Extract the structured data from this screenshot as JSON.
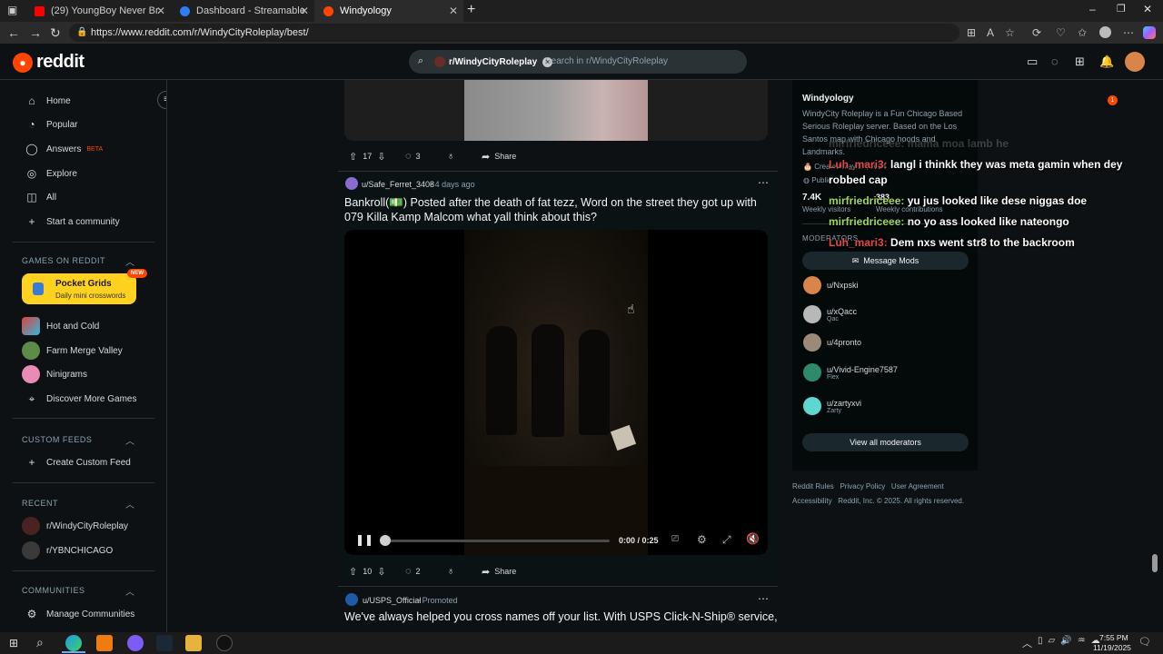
{
  "browser": {
    "tabs": [
      {
        "label": "(29) YoungBoy Never Broke Again...",
        "color": "#ff0000"
      },
      {
        "label": "Dashboard - Streamable",
        "color": "#2f7df6"
      },
      {
        "label": "Windyology",
        "color": "#ff4500"
      }
    ],
    "new_tab": "+",
    "url": "https://www.reddit.com/r/WindyCityRoleplay/best/"
  },
  "header": {
    "logo_text": "reddit",
    "search_chip": "r/WindyCityRoleplay",
    "search_placeholder": "Search in r/WindyCityRoleplay",
    "notif_count": "1"
  },
  "sidebar": {
    "main": [
      {
        "label": "Home",
        "icon": "home-icon"
      },
      {
        "label": "Popular",
        "icon": "popular-icon"
      },
      {
        "label": "Answers",
        "icon": "answers-icon",
        "badge": "BETA"
      },
      {
        "label": "Explore",
        "icon": "explore-icon"
      },
      {
        "label": "All",
        "icon": "all-icon"
      },
      {
        "label": "Start a community",
        "icon": "plus-icon"
      }
    ],
    "games_title": "GAMES ON REDDIT",
    "featured_game": {
      "name": "Pocket Grids",
      "sub": "Daily mini crosswords",
      "badge": "NEW"
    },
    "games": [
      "Hot and Cold",
      "Farm Merge Valley",
      "Ninigrams",
      "Discover More Games"
    ],
    "custom_title": "CUSTOM FEEDS",
    "custom_create": "Create Custom Feed",
    "recent_title": "RECENT",
    "recent": [
      "r/WindyCityRoleplay",
      "r/YBNCHICAGO"
    ],
    "communities_title": "COMMUNITIES",
    "manage": "Manage Communities"
  },
  "posts": [
    {
      "votes": "17",
      "comments": "3",
      "share": "Share"
    },
    {
      "author": "u/Safe_Ferret_3408",
      "age": "4 days ago",
      "title_line1": "Bankroll(💵) Posted after the death of fat tezz, Word on the street they got up with",
      "title_line2": "079 Killa Kamp Malcom what yall think about this?",
      "time": "0:00 / 0:25",
      "votes": "10",
      "comments": "2",
      "share": "Share"
    },
    {
      "author": "u/USPS_Official",
      "tag": "Promoted",
      "title": "We've always helped you cross names off your list. With USPS Click-N-Ship® service,"
    }
  ],
  "about": {
    "name": "Windyology",
    "desc": "WindyCity Roleplay is a Fun Chicago Based Serious Roleplay server. Based on the Los Santos map with Chicago hoods and Landmarks.",
    "created": "Created May 17, 2024",
    "public": "Public",
    "visitors_num": "7.4K",
    "visitors_label": "Weekly visitors",
    "contrib_num": "383",
    "contrib_label": "Weekly contributions",
    "mods_title": "MODERATORS",
    "message_mods": "Message Mods",
    "mods": [
      {
        "name": "u/Nxpski",
        "flair": ""
      },
      {
        "name": "u/xQacc",
        "flair": "Qac"
      },
      {
        "name": "u/4pronto",
        "flair": ""
      },
      {
        "name": "u/Vivid-Engine7587",
        "flair": "Flex"
      },
      {
        "name": "u/zartyxvi",
        "flair": "Zarty"
      }
    ],
    "view_all": "View all moderators"
  },
  "footer": {
    "links1": "Reddit Rules   Privacy Policy   User Agreement",
    "links2": "Accessibility   Reddit, Inc. © 2025. All rights reserved."
  },
  "chat": [
    {
      "user": "Luh_mari3:",
      "text": "langl i thinkk they was meta gamin when dey",
      "red": true
    },
    {
      "user": "",
      "text": "robbed cap",
      "red": false
    },
    {
      "user": "mirfriedriceee:",
      "text": "yu jus looked like dese niggas doe",
      "red": false
    },
    {
      "user": "mirfriedriceee:",
      "text": "no yo ass looked like nateongo",
      "red": false
    },
    {
      "user": "Luh_mari3:",
      "text": "Dem nxs went str8 to the backroom",
      "red": true
    }
  ],
  "chat_faded": "mirfriedriceee: mama moa lamb he",
  "taskbar": {
    "time": "7:55 PM",
    "date": "11/19/2025"
  }
}
